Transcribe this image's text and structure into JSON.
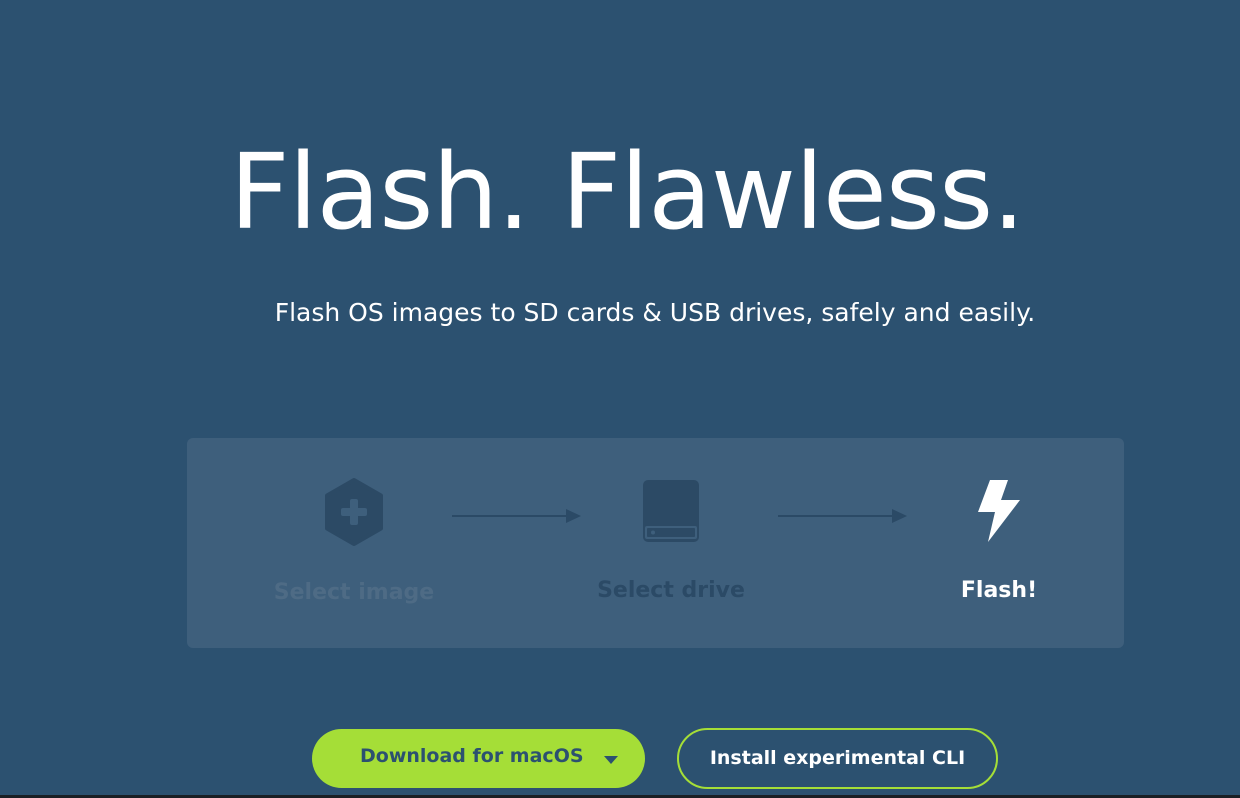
{
  "hero": {
    "title": "Flash. Flawless.",
    "subtitle": "Flash OS images to SD cards & USB drives, safely and easily."
  },
  "steps": [
    {
      "label": "Select image",
      "icon": "hexagon-plus-icon"
    },
    {
      "label": "Select drive",
      "icon": "drive-icon"
    },
    {
      "label": "Flash!",
      "icon": "lightning-bolt-icon"
    }
  ],
  "actions": {
    "download_label": "Download for macOS",
    "cli_label": "Install experimental CLI"
  },
  "colors": {
    "background": "#2c5170",
    "panel": "#3e5f7c",
    "accent_green": "#a5de37",
    "muted_step": "#4e6b85",
    "dark_step": "#2b4a66"
  }
}
